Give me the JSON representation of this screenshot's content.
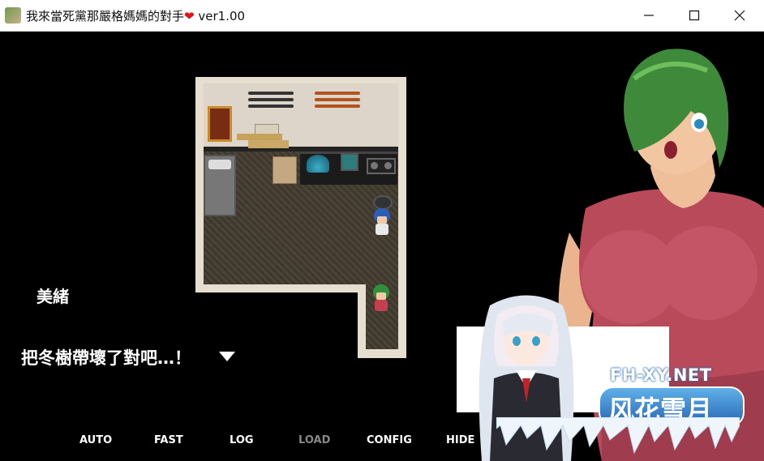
{
  "window": {
    "title": "我來當死黨那嚴格媽媽的對手",
    "title_heart": "❤",
    "version": "ver1.00"
  },
  "dialogue": {
    "speaker": "美緒",
    "text": "把冬樹帶壞了對吧…！"
  },
  "menu": [
    {
      "label": "AUTO",
      "enabled": true
    },
    {
      "label": "FAST",
      "enabled": true
    },
    {
      "label": "LOG",
      "enabled": true
    },
    {
      "label": "LOAD",
      "enabled": false
    },
    {
      "label": "CONFIG",
      "enabled": true
    },
    {
      "label": "HIDE",
      "enabled": true
    }
  ],
  "watermark": {
    "url": "FH-XY.NET",
    "logo": "风花雪月"
  },
  "colors": {
    "heart": "#d11111",
    "text": "#ffffff",
    "disabled_menu": "#888888",
    "background": "#000000"
  }
}
